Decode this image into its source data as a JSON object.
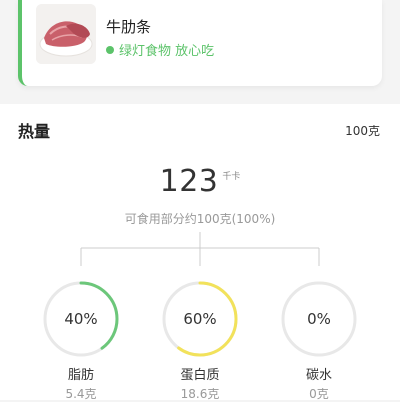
{
  "food": {
    "name": "牛肋条",
    "tag": "绿灯食物 放心吃",
    "tag_color": "#5cc36a",
    "image_icon": "beef-rib-photo"
  },
  "energy": {
    "title": "热量",
    "basis": "100克",
    "value": "123",
    "unit": "千卡",
    "edible_note": "可食用部分约100克(100%)"
  },
  "macros": [
    {
      "name": "脂肪",
      "percent_label": "40%",
      "percent": 40,
      "amount": "5.4克",
      "color": "#6cc77a"
    },
    {
      "name": "蛋白质",
      "percent_label": "60%",
      "percent": 60,
      "amount": "18.6克",
      "color": "#f2e25b"
    },
    {
      "name": "碳水",
      "percent_label": "0%",
      "percent": 0,
      "amount": "0克",
      "color": "#cccccc"
    }
  ]
}
